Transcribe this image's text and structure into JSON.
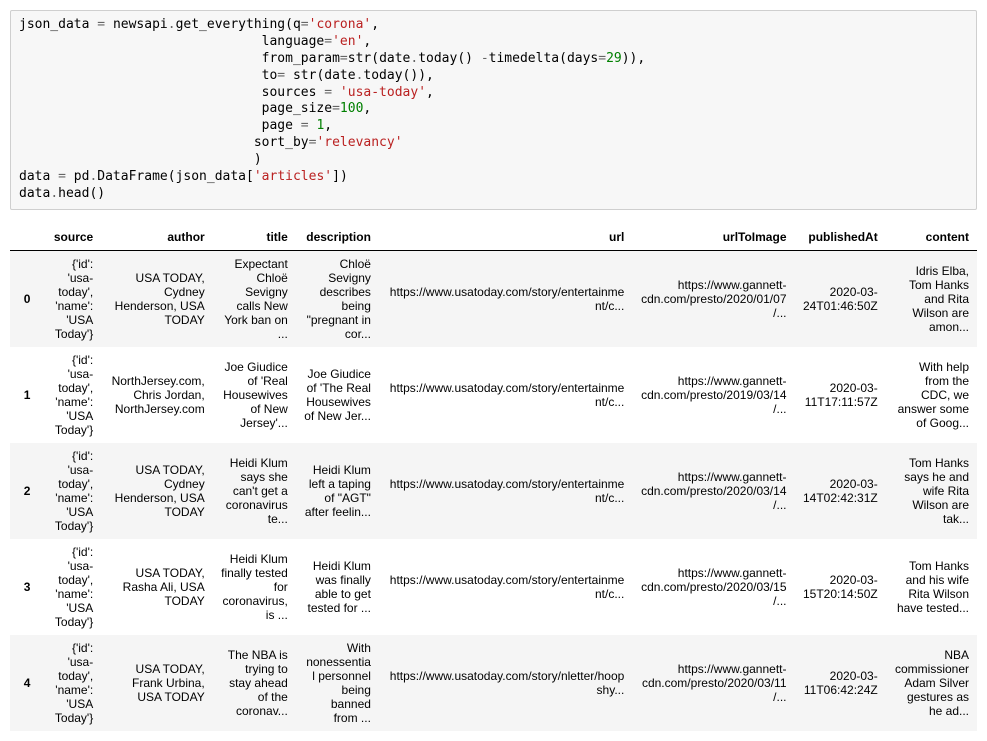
{
  "code": {
    "q": "'corona'",
    "language": "'en'",
    "days": "29",
    "sources": "'usa-today'",
    "page_size": "100",
    "page": "1",
    "sort_by": "'relevancy'",
    "articles_key": "'articles'"
  },
  "table": {
    "columns": [
      "source",
      "author",
      "title",
      "description",
      "url",
      "urlToImage",
      "publishedAt",
      "content"
    ],
    "rows": [
      {
        "index": "0",
        "source": "{'id': 'usa-today', 'name': 'USA Today'}",
        "author": "USA TODAY, Cydney Henderson, USA TODAY",
        "title": "Expectant Chloë Sevigny calls New York ban on ...",
        "description": "Chloë Sevigny describes being \"pregnant in cor...",
        "url": "https://www.usatoday.com/story/entertainment/c...",
        "urlToImage": "https://www.gannett-cdn.com/presto/2020/01/07/...",
        "publishedAt": "2020-03-24T01:46:50Z",
        "content": "Idris Elba, Tom Hanks and Rita Wilson are amon..."
      },
      {
        "index": "1",
        "source": "{'id': 'usa-today', 'name': 'USA Today'}",
        "author": "NorthJersey.com, Chris Jordan, NorthJersey.com",
        "title": "Joe Giudice of 'Real Housewives of New Jersey'...",
        "description": "Joe Giudice of 'The Real Housewives of New Jer...",
        "url": "https://www.usatoday.com/story/entertainment/c...",
        "urlToImage": "https://www.gannett-cdn.com/presto/2019/03/14/...",
        "publishedAt": "2020-03-11T17:11:57Z",
        "content": "With help from the CDC, we answer some of Goog..."
      },
      {
        "index": "2",
        "source": "{'id': 'usa-today', 'name': 'USA Today'}",
        "author": "USA TODAY, Cydney Henderson, USA TODAY",
        "title": "Heidi Klum says she can't get a coronavirus te...",
        "description": "Heidi Klum left a taping of \"AGT\" after feelin...",
        "url": "https://www.usatoday.com/story/entertainment/c...",
        "urlToImage": "https://www.gannett-cdn.com/presto/2020/03/14/...",
        "publishedAt": "2020-03-14T02:42:31Z",
        "content": "Tom Hanks says he and wife Rita Wilson are tak..."
      },
      {
        "index": "3",
        "source": "{'id': 'usa-today', 'name': 'USA Today'}",
        "author": "USA TODAY, Rasha Ali, USA TODAY",
        "title": "Heidi Klum finally tested for coronavirus, is ...",
        "description": "Heidi Klum was finally able to get tested for ...",
        "url": "https://www.usatoday.com/story/entertainment/c...",
        "urlToImage": "https://www.gannett-cdn.com/presto/2020/03/15/...",
        "publishedAt": "2020-03-15T20:14:50Z",
        "content": "Tom Hanks and his wife Rita Wilson have tested..."
      },
      {
        "index": "4",
        "source": "{'id': 'usa-today', 'name': 'USA Today'}",
        "author": "USA TODAY, Frank Urbina, USA TODAY",
        "title": "The NBA is trying to stay ahead of the coronav...",
        "description": "With nonessential personnel being banned from ...",
        "url": "https://www.usatoday.com/story/nletter/hoopshy...",
        "urlToImage": "https://www.gannett-cdn.com/presto/2020/03/11/...",
        "publishedAt": "2020-03-11T06:42:24Z",
        "content": "NBA commissioner Adam Silver gestures as he ad..."
      }
    ]
  }
}
